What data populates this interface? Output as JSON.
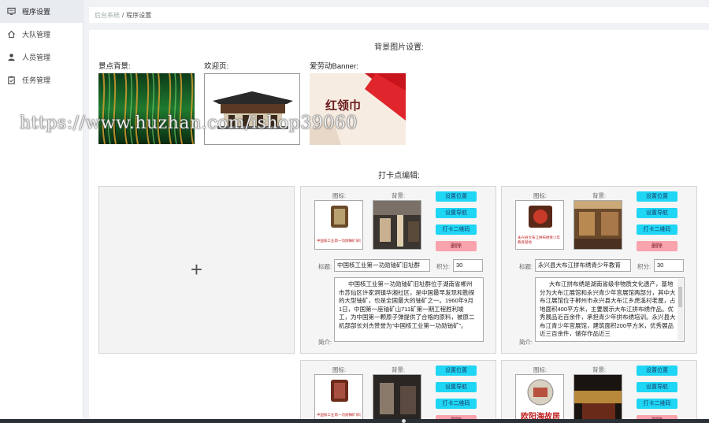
{
  "sidebar": {
    "items": [
      {
        "label": "程序设置",
        "icon": "monitor-icon",
        "active": true
      },
      {
        "label": "大队管理",
        "icon": "home-icon"
      },
      {
        "label": "人员管理",
        "icon": "user-icon"
      },
      {
        "label": "任务管理",
        "icon": "clipboard-icon"
      }
    ]
  },
  "breadcrumb": {
    "home": "后台系统",
    "sep": "/",
    "current": "程序设置"
  },
  "background_settings": {
    "title": "背景图片设置:",
    "items": [
      {
        "label": "景点背景:"
      },
      {
        "label": "欢迎页:"
      },
      {
        "label": "爱劳动Banner:",
        "image_text": "红领巾"
      }
    ]
  },
  "checkin": {
    "title": "打卡点编辑:",
    "add_symbol": "+",
    "labels": {
      "icon": "图标:",
      "background": "背景:",
      "title": "标题:",
      "points": "积分:",
      "intro": "简介:"
    },
    "buttons": {
      "set_location": "设置位置",
      "set_nav": "设置导航",
      "qr": "打卡二维码",
      "delete": "删除"
    },
    "cards": [
      {
        "title": "中国核工业第一功勋铀矿旧址群",
        "points": "30",
        "icon_caption": "中国核工业第一功勋铀矿旧址群",
        "intro": "中国核工业第一功勋铀矿旧址群位于湖南省郴州市苏仙区许家洞镇华湘社区，是中国最早发现和勘探的大型铀矿，也是全国最大的铀矿之一。1960年9月1日，中国第一座铀矿山711矿第一期工程胜利竣工，为中国第一颗原子弹提供了合格的原料，被原二机部部长刘杰赞誉为“中国核工业第一功勋铀矿”。"
      },
      {
        "title": "永兴县大布江拼布绣青少年教育",
        "points": "30",
        "icon_caption": "永兴县大布江拼布绣青少年教育基地",
        "intro": "大布江拼布绣是湖南省级非物质文化遗产，基地分为大布江展馆和永兴青少年宫展馆两部分，其中大布江展馆位于郴州市永兴县大布江乡虎溪村老屋，占地面积400平方米，主要展示大布江拼布绣作品。优秀展品近百余件，承担青少年拼布绣培训。永兴县大布江青少年宫展馆，建筑面积200平方米，优秀展品近三百余件，储存作品近三"
      },
      {
        "icon_caption": "中国核工业第一功勋铀矿旧址群"
      },
      {
        "icon_caption": "欧阳海故居"
      }
    ]
  },
  "watermark": "https://www.huzhan.com/ishop39060"
}
